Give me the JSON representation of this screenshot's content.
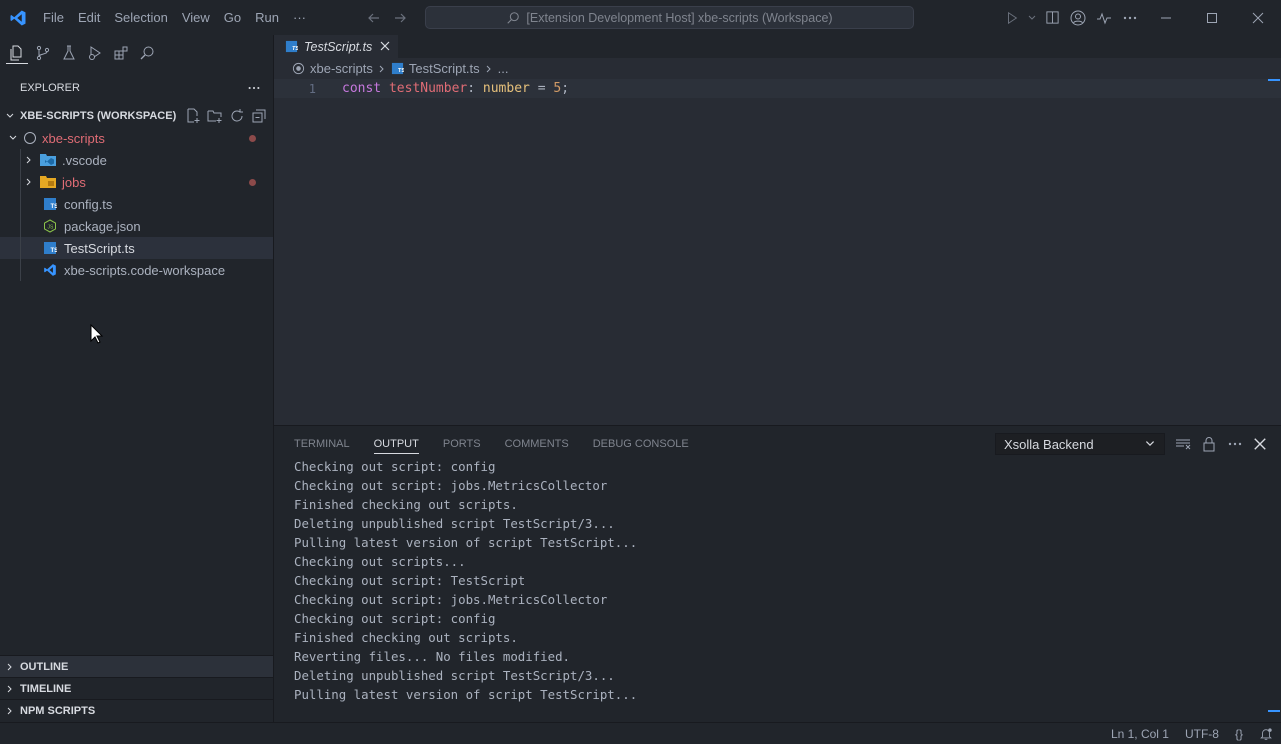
{
  "titlebar": {
    "menu": [
      "File",
      "Edit",
      "Selection",
      "View",
      "Go",
      "Run",
      "···"
    ],
    "command_center": "[Extension Development Host] xbe-scripts (Workspace)"
  },
  "sidebar": {
    "header": "EXPLORER",
    "workspace": "XBE-SCRIPTS (WORKSPACE)",
    "root_folder": "xbe-scripts",
    "items": [
      {
        "label": "xbe-scripts",
        "type": "root"
      },
      {
        "label": ".vscode",
        "type": "folder-vscode"
      },
      {
        "label": "jobs",
        "type": "folder-jobs"
      },
      {
        "label": "config.ts",
        "type": "ts"
      },
      {
        "label": "package.json",
        "type": "json"
      },
      {
        "label": "TestScript.ts",
        "type": "ts"
      },
      {
        "label": "xbe-scripts.code-workspace",
        "type": "workspace"
      }
    ],
    "sections": [
      "OUTLINE",
      "TIMELINE",
      "NPM SCRIPTS"
    ]
  },
  "editor": {
    "tab_label": "TestScript.ts",
    "breadcrumb": [
      "xbe-scripts",
      "TestScript.ts",
      "..."
    ],
    "line_number": "1",
    "code": {
      "kw": "const",
      "var": "testNumber",
      "colon": ":",
      "type": "number",
      "eq": " = ",
      "num": "5",
      "end": ";"
    }
  },
  "panel": {
    "tabs": [
      "TERMINAL",
      "OUTPUT",
      "PORTS",
      "COMMENTS",
      "DEBUG CONSOLE"
    ],
    "active_tab": "OUTPUT",
    "channel": "Xsolla Backend",
    "output_lines": [
      "Checking out script: config",
      "Checking out script: jobs.MetricsCollector",
      "Finished checking out scripts.",
      "Deleting unpublished script TestScript/3...",
      "Pulling latest version of script TestScript...",
      "Checking out scripts...",
      "Checking out script: TestScript",
      "Checking out script: jobs.MetricsCollector",
      "Checking out script: config",
      "Finished checking out scripts.",
      "Reverting files... No files modified.",
      "Deleting unpublished script TestScript/3...",
      "Pulling latest version of script TestScript..."
    ]
  },
  "statusbar": {
    "position": "Ln 1, Col 1",
    "encoding": "UTF-8",
    "braces": "{}"
  },
  "colors": {
    "accent": "#3794ff",
    "modified_red": "#e06c75",
    "bg": "#282c34"
  }
}
